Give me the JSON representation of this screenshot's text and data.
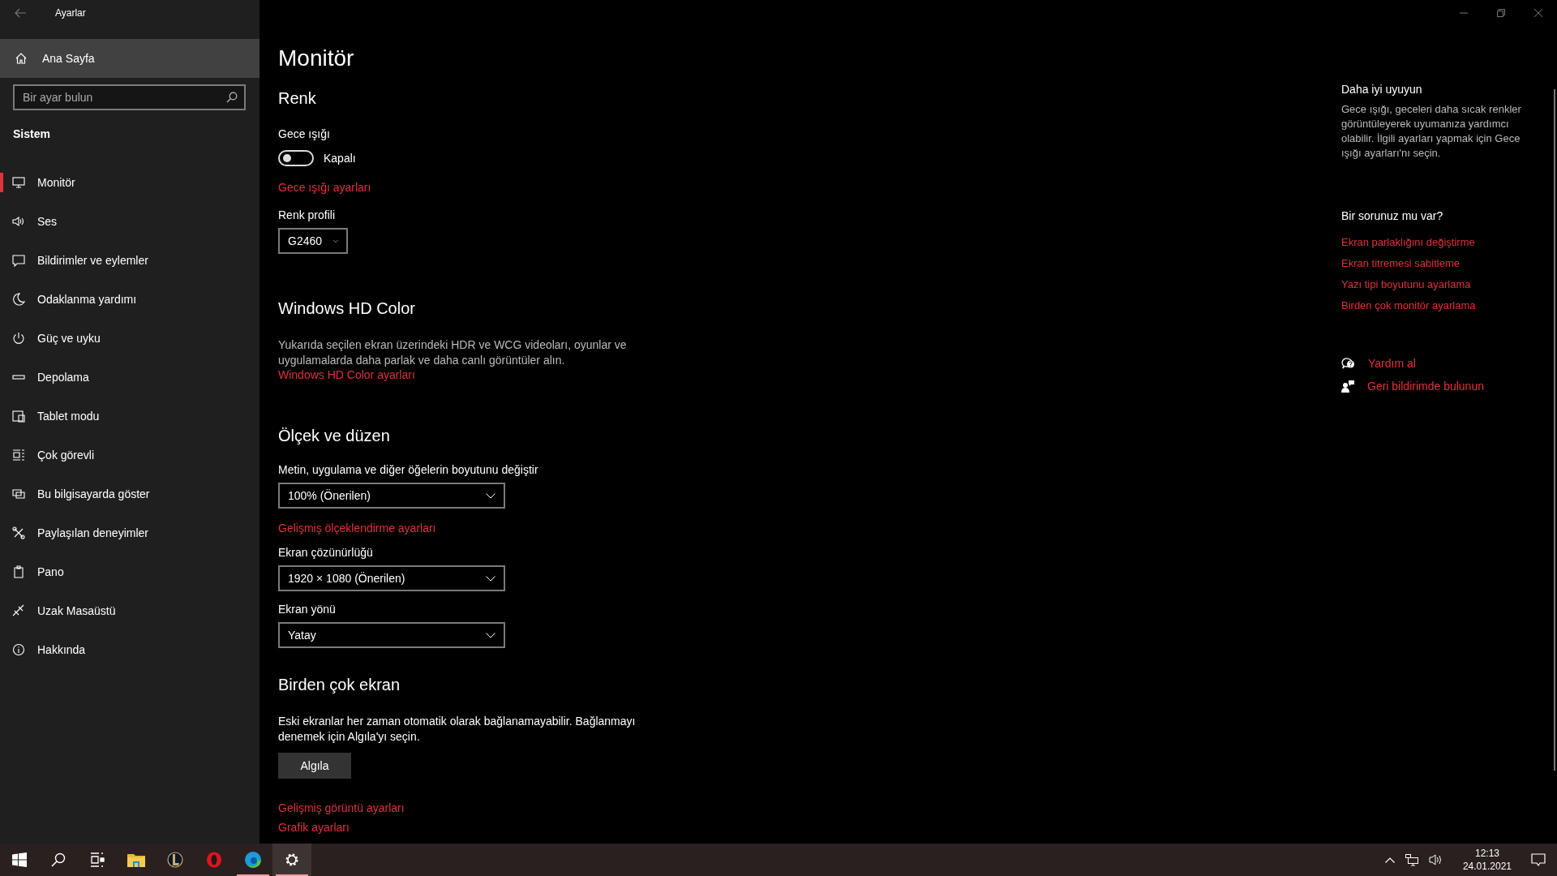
{
  "window": {
    "title": "Ayarlar"
  },
  "sidebar": {
    "home": "Ana Sayfa",
    "search": {
      "placeholder": "Bir ayar bulun"
    },
    "section": "Sistem",
    "items": [
      {
        "label": "Monitör",
        "selected": true
      },
      {
        "label": "Ses",
        "selected": false
      },
      {
        "label": "Bildirimler ve eylemler",
        "selected": false
      },
      {
        "label": "Odaklanma yardımı",
        "selected": false
      },
      {
        "label": "Güç ve uyku",
        "selected": false
      },
      {
        "label": "Depolama",
        "selected": false
      },
      {
        "label": "Tablet modu",
        "selected": false
      },
      {
        "label": "Çok görevli",
        "selected": false
      },
      {
        "label": "Bu bilgisayarda göster",
        "selected": false
      },
      {
        "label": "Paylaşılan deneyimler",
        "selected": false
      },
      {
        "label": "Pano",
        "selected": false
      },
      {
        "label": "Uzak Masaüstü",
        "selected": false
      },
      {
        "label": "Hakkında",
        "selected": false
      }
    ]
  },
  "main": {
    "title": "Monitör",
    "color": {
      "heading": "Renk",
      "night_light": {
        "label": "Gece ışığı",
        "on": false,
        "state_text": "Kapalı"
      },
      "night_light_link": "Gece ışığı ayarları",
      "profile": {
        "label": "Renk profili",
        "value": "G2460"
      }
    },
    "hd_color": {
      "heading": "Windows HD Color",
      "description": "Yukarıda seçilen ekran üzerindeki HDR ve WCG videoları, oyunlar ve uygulamalarda daha parlak ve daha canlı görüntüler alın.",
      "link": "Windows HD Color ayarları"
    },
    "scale": {
      "heading": "Ölçek ve düzen",
      "size": {
        "label": "Metin, uygulama ve diğer öğelerin boyutunu değiştir",
        "value": "100% (Önerilen)"
      },
      "advanced_link": "Gelişmiş ölçeklendirme ayarları",
      "resolution": {
        "label": "Ekran çözünürlüğü",
        "value": "1920 × 1080 (Önerilen)"
      },
      "orientation": {
        "label": "Ekran yönü",
        "value": "Yatay"
      }
    },
    "multi": {
      "heading": "Birden çok ekran",
      "description": "Eski ekranlar her zaman otomatik olarak bağlanamayabilir. Bağlanmayı denemek için Algıla'yı seçin.",
      "button": "Algıla",
      "links": [
        "Gelişmiş görüntü ayarları",
        "Grafik ayarları"
      ]
    }
  },
  "aside": {
    "sleep": {
      "heading": "Daha iyi uyuyun",
      "text": "Gece ışığı, geceleri daha sıcak renkler görüntüleyerek uyumanıza yardımcı olabilir. İlgili ayarları yapmak için Gece ışığı ayarları'nı seçin."
    },
    "problems": {
      "heading": "Bir sorunuz mu var?",
      "links": [
        "Ekran parlaklığını değiştirme",
        "Ekran titremesi sabitleme",
        "Yazı tipi boyutunu ayarlama",
        "Birden çok monitör ayarlama"
      ]
    },
    "help": [
      {
        "kind": "help",
        "label": "Yardım al"
      },
      {
        "kind": "feedback",
        "label": "Geri bildirimde bulunun"
      }
    ]
  },
  "taskbar": {
    "apps": [
      {
        "kind": "start",
        "running": false,
        "selected": false
      },
      {
        "kind": "search",
        "running": false,
        "selected": false
      },
      {
        "kind": "taskview",
        "running": false,
        "selected": false
      },
      {
        "kind": "folder",
        "running": false,
        "selected": false
      },
      {
        "kind": "game",
        "running": false,
        "selected": false
      },
      {
        "kind": "opera",
        "running": false,
        "selected": false
      },
      {
        "kind": "edge",
        "running": true,
        "selected": false
      },
      {
        "kind": "settings",
        "running": true,
        "selected": true
      }
    ],
    "time": "12:13",
    "date": "24.01.2021"
  }
}
